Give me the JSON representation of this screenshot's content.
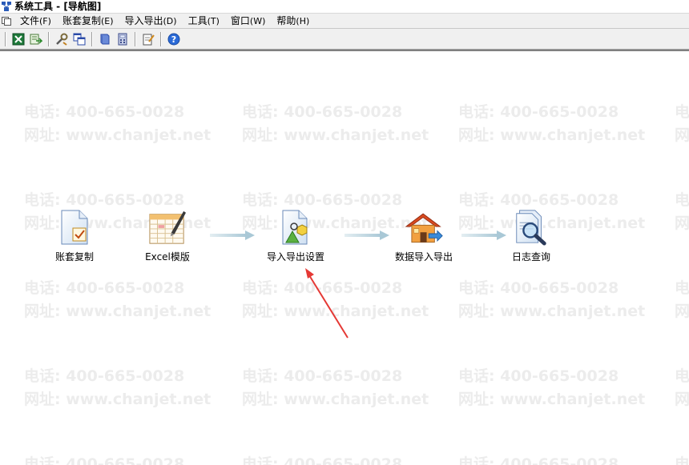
{
  "window": {
    "title": "系统工具 - [导航图]"
  },
  "menubar": {
    "items": [
      {
        "label": "文件",
        "accel": "(F)"
      },
      {
        "label": "账套复制",
        "accel": "(E)"
      },
      {
        "label": "导入导出",
        "accel": "(D)"
      },
      {
        "label": "工具",
        "accel": "(T)"
      },
      {
        "label": "窗口",
        "accel": "(W)"
      },
      {
        "label": "帮助",
        "accel": "(H)"
      }
    ]
  },
  "toolbar": {
    "buttons": [
      {
        "name": "excel-icon"
      },
      {
        "name": "export-icon"
      },
      {
        "name": "tools-icon"
      },
      {
        "name": "copy-window-icon"
      },
      {
        "name": "book-icon"
      },
      {
        "name": "calculator-icon"
      },
      {
        "name": "notepad-icon"
      },
      {
        "name": "help-icon"
      }
    ]
  },
  "watermark": {
    "phone": "电话: 400-665-0028",
    "website": "网址: www.chanjet.net"
  },
  "nodes": {
    "account_copy": "账套复制",
    "excel_template": "Excel模版",
    "import_export_settings": "导入导出设置",
    "data_import_export": "数据导入导出",
    "log_query": "日志查询"
  },
  "colors": {
    "annotation_arrow": "#e53935",
    "flow_arrow": "#a9c8d6",
    "watermark": "#ececec"
  }
}
